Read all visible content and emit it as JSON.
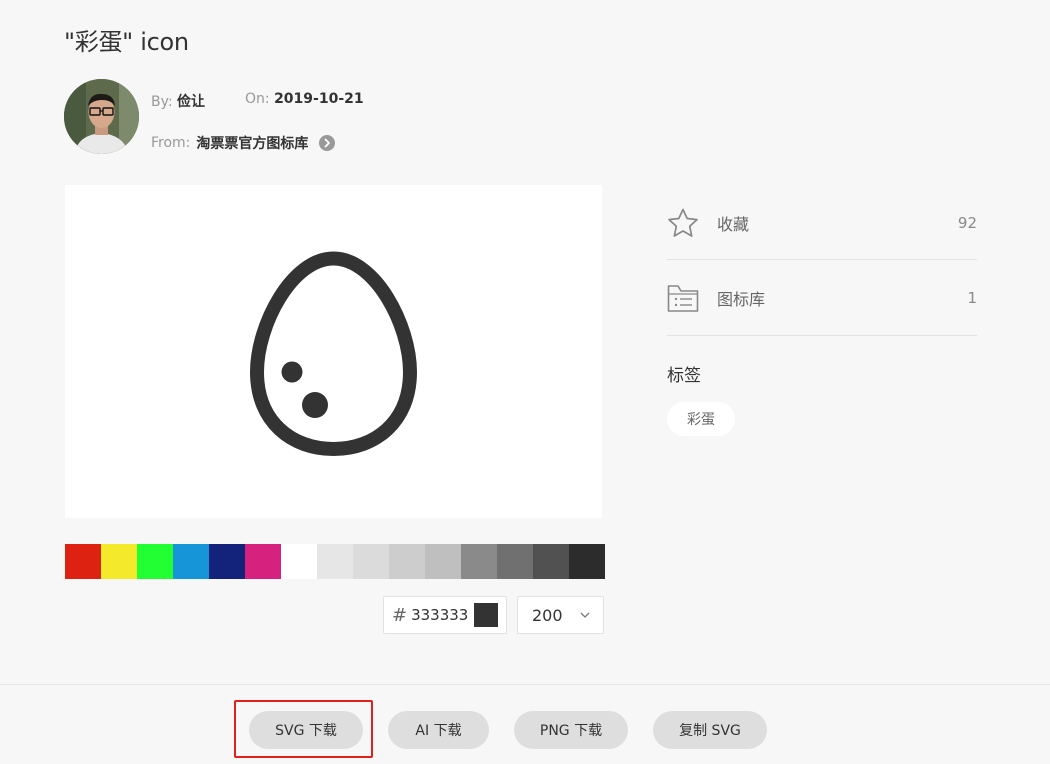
{
  "page": {
    "title": "\"彩蛋\" icon"
  },
  "author": {
    "by_label": "By:",
    "by_value": "俭让",
    "on_label": "On:",
    "on_value": "2019-10-21",
    "from_label": "From:",
    "from_value": "淘票票官方图标库",
    "avatar_icon": "user-avatar"
  },
  "palette": {
    "swatches": [
      "#dd2211",
      "#f5e92c",
      "#22ff33",
      "#1795d9",
      "#13227a",
      "#d6217f",
      "#ffffff",
      "#e6e6e6",
      "#dbdbdb",
      "#cdcdcd",
      "#bfbfbf",
      "#8a8a8a",
      "#707070",
      "#515151",
      "#2c2c2c"
    ]
  },
  "controls": {
    "hash": "#",
    "color_hex": "333333",
    "color_value": "#333333",
    "size": "200",
    "size_icon": "chevron-down-icon"
  },
  "sidebar": {
    "favorite": {
      "label": "收藏",
      "count": "92",
      "icon": "star-icon"
    },
    "library": {
      "label": "图标库",
      "count": "1",
      "icon": "folder-list-icon"
    },
    "tags_title": "标签",
    "tags": [
      "彩蛋"
    ]
  },
  "actions": {
    "svg_download": "SVG 下载",
    "ai_download": "AI 下载",
    "png_download": "PNG 下载",
    "copy_svg": "复制 SVG"
  },
  "colors": {
    "icon": "#333333",
    "highlight": "#e0201a"
  }
}
